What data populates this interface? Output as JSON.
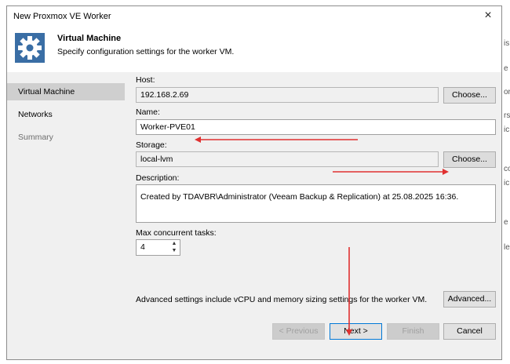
{
  "window": {
    "title": "New Proxmox VE Worker",
    "close_glyph": "×"
  },
  "header": {
    "icon": "gear-icon",
    "title": "Virtual Machine",
    "subtitle": "Specify configuration settings for the worker VM."
  },
  "nav": {
    "items": [
      {
        "label": "Virtual Machine",
        "state": "active"
      },
      {
        "label": "Networks",
        "state": "enabled"
      },
      {
        "label": "Summary",
        "state": "disabled"
      }
    ]
  },
  "form": {
    "host": {
      "label": "Host:",
      "value": "192.168.2.69",
      "button": "Choose..."
    },
    "name": {
      "label": "Name:",
      "value": "Worker-PVE01"
    },
    "storage": {
      "label": "Storage:",
      "value": "local-lvm",
      "button": "Choose..."
    },
    "description": {
      "label": "Description:",
      "value": "Created by TDAVBR\\Administrator (Veeam Backup & Replication) at 25.08.2025 16:36."
    },
    "max_tasks": {
      "label": "Max concurrent tasks:",
      "value": "4"
    },
    "advanced": {
      "text": "Advanced settings include vCPU and memory sizing settings for the worker VM.",
      "button": "Advanced..."
    }
  },
  "footer": {
    "previous": "< Previous",
    "next": "Next >",
    "finish": "Finish",
    "cancel": "Cancel"
  },
  "background": {
    "fragments": [
      "is",
      "e",
      "or",
      "rs",
      "ic",
      "co",
      "ic",
      "e",
      "le"
    ]
  },
  "colors": {
    "annotation_arrow": "#e03030",
    "active_nav": "#cfcfcf",
    "primary_border": "#0078d7"
  }
}
